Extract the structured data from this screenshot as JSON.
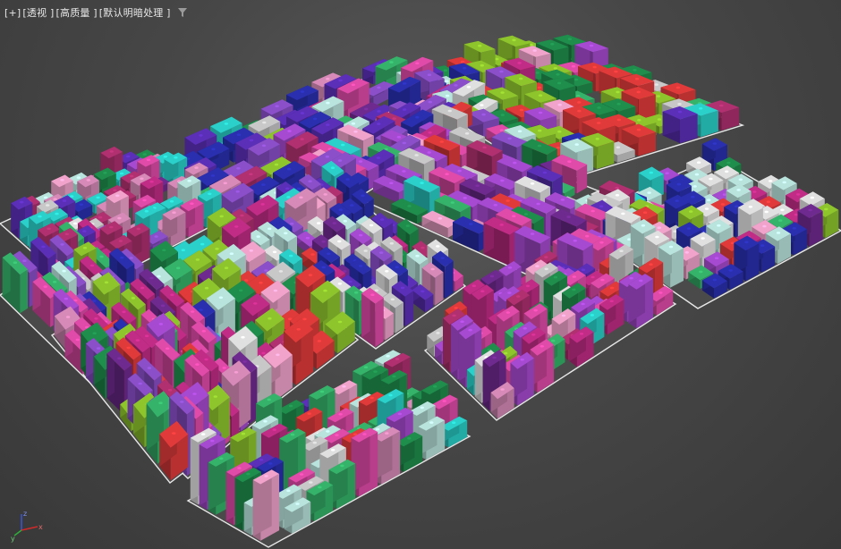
{
  "viewport": {
    "menu_plus": "[+]",
    "view_label": "[透视 ]",
    "shading_label": "[高质量 ]",
    "lighting_label": "[默认明暗处理 ]",
    "filter_icon": "funnel-icon"
  },
  "gizmo": {
    "axes": [
      "x",
      "y",
      "z"
    ],
    "colors": {
      "x": "#d22a2a",
      "y": "#2fae3a",
      "z": "#3a55d8"
    }
  },
  "scene": {
    "background": "#474747",
    "lot_outline_color": "#e8e8e8",
    "brick_palette": [
      "#e04aa8",
      "#c12c86",
      "#8a4fc9",
      "#5b2fb8",
      "#2a2fb0",
      "#e0e0e0",
      "#b9e4dd",
      "#36b36a",
      "#1f8d4c",
      "#e03a3a",
      "#8ec52d",
      "#2ad0c9",
      "#d78ab8",
      "#b03070",
      "#f2a3cc",
      "#6f2a8f",
      "#c8c8c8",
      "#a64ad1"
    ]
  }
}
